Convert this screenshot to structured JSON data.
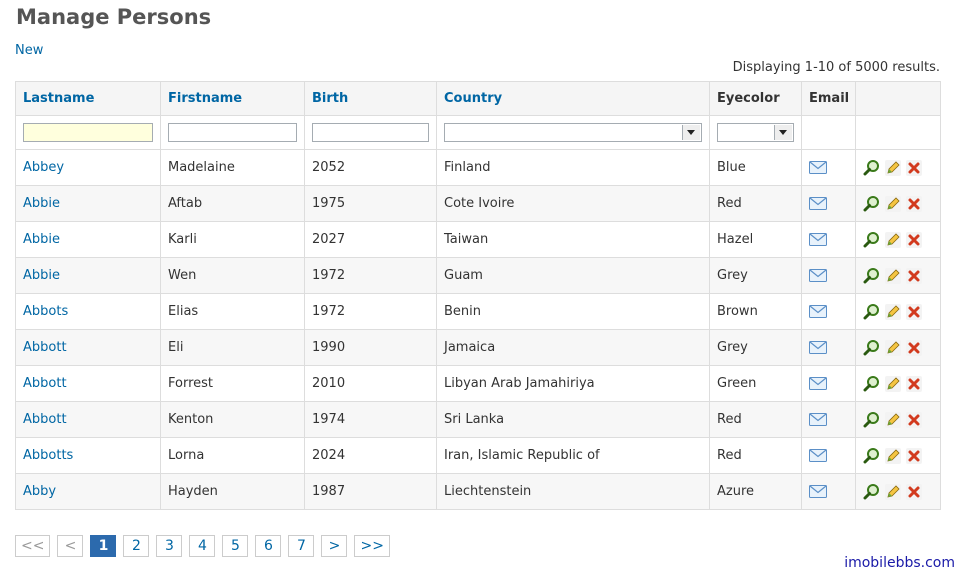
{
  "page": {
    "title": "Manage Persons",
    "new_link": "New",
    "summary": "Displaying 1-10 of 5000 results."
  },
  "table": {
    "columns": [
      "Lastname",
      "Firstname",
      "Birth",
      "Country",
      "Eyecolor",
      "Email"
    ],
    "rows": [
      {
        "lastname": "Abbey",
        "firstname": "Madelaine",
        "birth": "2052",
        "country": "Finland",
        "eyecolor": "Blue"
      },
      {
        "lastname": "Abbie",
        "firstname": "Aftab",
        "birth": "1975",
        "country": "Cote Ivoire",
        "eyecolor": "Red"
      },
      {
        "lastname": "Abbie",
        "firstname": "Karli",
        "birth": "2027",
        "country": "Taiwan",
        "eyecolor": "Hazel"
      },
      {
        "lastname": "Abbie",
        "firstname": "Wen",
        "birth": "1972",
        "country": "Guam",
        "eyecolor": "Grey"
      },
      {
        "lastname": "Abbots",
        "firstname": "Elias",
        "birth": "1972",
        "country": "Benin",
        "eyecolor": "Brown"
      },
      {
        "lastname": "Abbott",
        "firstname": "Eli",
        "birth": "1990",
        "country": "Jamaica",
        "eyecolor": "Grey"
      },
      {
        "lastname": "Abbott",
        "firstname": "Forrest",
        "birth": "2010",
        "country": "Libyan Arab Jamahiriya",
        "eyecolor": "Green"
      },
      {
        "lastname": "Abbott",
        "firstname": "Kenton",
        "birth": "1974",
        "country": "Sri Lanka",
        "eyecolor": "Red"
      },
      {
        "lastname": "Abbotts",
        "firstname": "Lorna",
        "birth": "2024",
        "country": "Iran, Islamic Republic of",
        "eyecolor": "Red"
      },
      {
        "lastname": "Abby",
        "firstname": "Hayden",
        "birth": "1987",
        "country": "Liechtenstein",
        "eyecolor": "Azure"
      }
    ],
    "icons": {
      "email": "envelope-icon",
      "view": "magnifier-icon",
      "edit": "pencil-icon",
      "delete": "delete-x-icon"
    }
  },
  "pager": {
    "first": "<<",
    "prev": "<",
    "pages": [
      "1",
      "2",
      "3",
      "4",
      "5",
      "6",
      "7"
    ],
    "current": "1",
    "next": ">",
    "last": ">>"
  },
  "footer": {
    "brand": "imobilebbs.com"
  },
  "colors": {
    "link": "#0066a4",
    "current_page": "#2c6aad",
    "filter_active": "#ffffdd",
    "title": "#555555"
  }
}
